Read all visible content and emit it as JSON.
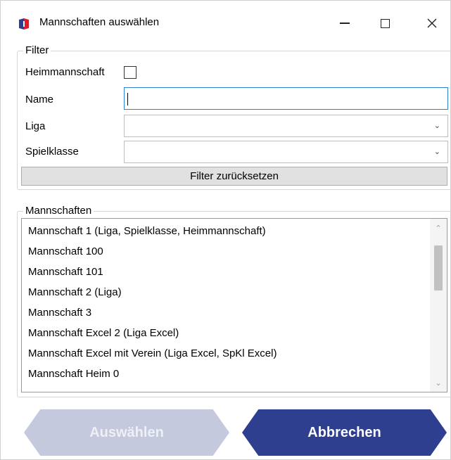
{
  "window": {
    "title": "Mannschaften auswählen"
  },
  "filter": {
    "group_title": "Filter",
    "home_team_label": "Heimmannschaft",
    "home_team_checked": false,
    "name_label": "Name",
    "name_value": "",
    "league_label": "Liga",
    "league_value": "",
    "class_label": "Spielklasse",
    "class_value": "",
    "reset_label": "Filter zurücksetzen"
  },
  "teams": {
    "group_title": "Mannschaften",
    "items": [
      "Mannschaft 1 (Liga, Spielklasse, Heimmannschaft)",
      "Mannschaft 100",
      "Mannschaft 101",
      "Mannschaft 2 (Liga)",
      "Mannschaft 3",
      "Mannschaft Excel 2 (Liga Excel)",
      "Mannschaft Excel mit Verein (Liga Excel, SpKl Excel)",
      "Mannschaft Heim 0"
    ]
  },
  "actions": {
    "select_label": "Auswählen",
    "cancel_label": "Abbrechen"
  },
  "colors": {
    "primary": "#2f3f8f",
    "disabled": "#c4c9dd",
    "focus": "#2f7fd6"
  }
}
